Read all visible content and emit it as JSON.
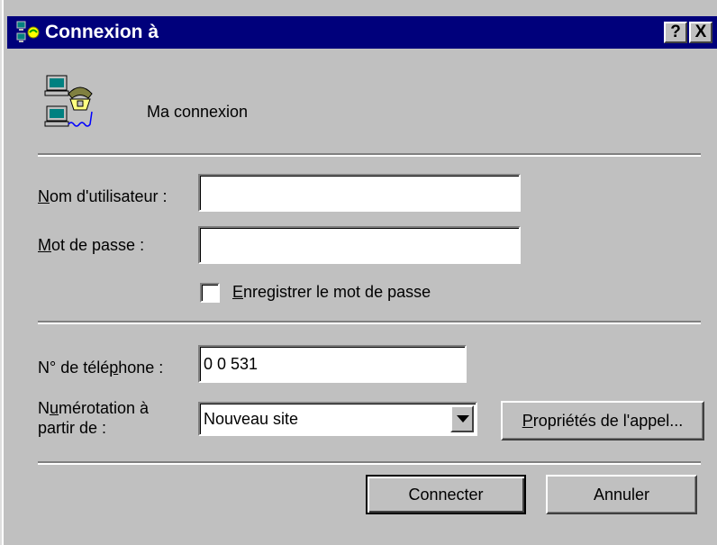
{
  "window": {
    "title": "Connexion à",
    "help_label": "?",
    "close_label": "X"
  },
  "connection": {
    "name": "Ma connexion",
    "icon": "dial-up-computers-phone-icon"
  },
  "username": {
    "label_access_key": "N",
    "label_rest": "om d'utilisateur :",
    "value": ""
  },
  "password": {
    "label_access_key": "M",
    "label_rest": "ot de passe :",
    "value": ""
  },
  "save_password": {
    "label_access_key": "E",
    "label_rest": "nregistrer le mot de passe",
    "checked": false
  },
  "phone": {
    "label_pre": "N° de télé",
    "label_access_key": "p",
    "label_post": "hone :",
    "value": "0 0 531"
  },
  "dial_from": {
    "label_line1_pre": "N",
    "label_line1_access_key": "u",
    "label_line1_post": "mérotation à",
    "label_line2": "partir de :",
    "selected": "Nouveau site"
  },
  "buttons": {
    "dial_properties_access_key": "P",
    "dial_properties_rest": "ropriétés de l'appel...",
    "connect": "Connecter",
    "cancel": "Annuler"
  },
  "colors": {
    "titlebar": "#00007b",
    "face": "#c0c0c0"
  }
}
